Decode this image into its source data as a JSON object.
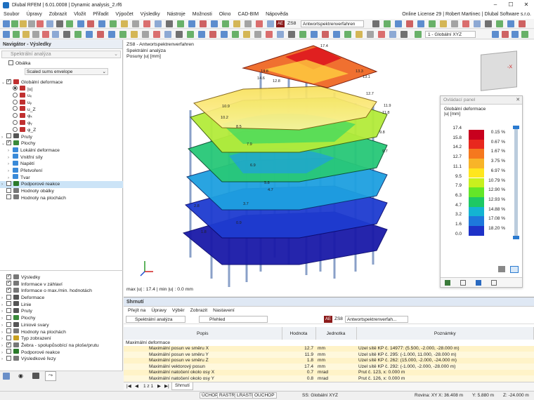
{
  "window": {
    "title": "Dlubal RFEM | 6.01.0008 | Dynamic analysis_2.rf6"
  },
  "menu": {
    "items": [
      "Soubor",
      "Úpravy",
      "Zobrazit",
      "Vložit",
      "Přiřadit",
      "Výpočet",
      "Výsledky",
      "Nástroje",
      "Možnosti",
      "Okno",
      "CAD-BIM",
      "Nápověda"
    ],
    "license": "Online License 29 | Robert Martinec | Dlubal Software s.r.o."
  },
  "toolbar": {
    "badge": "AE",
    "loadcase": "ZS8",
    "loadcase_name": "Antwortspektrenverfahren",
    "view_badge": "1 - Globální XYZ"
  },
  "navigator": {
    "title": "Navigátor - Výsledky",
    "dropdown": "Spektrální analýza",
    "envelope_label": "Obálka",
    "envelope_value": "Scaled sums envelope",
    "tree": [
      {
        "label": "Globální deformace",
        "indent": 0,
        "kind": "check",
        "on": true,
        "tw": "⌄",
        "icon": "#c03030"
      },
      {
        "label": "|u|",
        "indent": 1,
        "kind": "radio",
        "on": true,
        "icon": "#c03030"
      },
      {
        "label": "uₓ",
        "indent": 1,
        "kind": "radio",
        "on": false,
        "icon": "#c03030"
      },
      {
        "label": "uᵧ",
        "indent": 1,
        "kind": "radio",
        "on": false,
        "icon": "#c03030"
      },
      {
        "label": "u_Z",
        "indent": 1,
        "kind": "radio",
        "on": false,
        "icon": "#c03030"
      },
      {
        "label": "φₓ",
        "indent": 1,
        "kind": "radio",
        "on": false,
        "icon": "#c03030"
      },
      {
        "label": "φᵧ",
        "indent": 1,
        "kind": "radio",
        "on": false,
        "icon": "#c03030"
      },
      {
        "label": "φ_Z",
        "indent": 1,
        "kind": "radio",
        "on": false,
        "icon": "#c03030"
      },
      {
        "label": "Pruty",
        "indent": 0,
        "kind": "check",
        "on": false,
        "tw": "›",
        "icon": "#555"
      },
      {
        "label": "Plochy",
        "indent": 0,
        "kind": "check",
        "on": true,
        "tw": "⌄",
        "icon": "#3a8a3a"
      },
      {
        "label": "Lokální deformace",
        "indent": 1,
        "kind": "none",
        "tw": "›",
        "icon": "#3a8ad8"
      },
      {
        "label": "Vnitřní síly",
        "indent": 1,
        "kind": "none",
        "tw": "›",
        "icon": "#3a8ad8"
      },
      {
        "label": "Napětí",
        "indent": 1,
        "kind": "none",
        "tw": "›",
        "icon": "#3a8ad8"
      },
      {
        "label": "Přetvoření",
        "indent": 1,
        "kind": "none",
        "tw": "›",
        "icon": "#3a8ad8"
      },
      {
        "label": "Tvar",
        "indent": 1,
        "kind": "none",
        "tw": "›",
        "icon": "#3a8ad8"
      },
      {
        "label": "Podporové reakce",
        "indent": 0,
        "kind": "check",
        "on": false,
        "tw": "›",
        "icon": "#2a7a2a",
        "sel": true
      },
      {
        "label": "Hodnoty obálky",
        "indent": 0,
        "kind": "check",
        "on": false,
        "tw": "",
        "icon": "#777"
      },
      {
        "label": "Hodnoty na plochách",
        "indent": 0,
        "kind": "check",
        "on": false,
        "tw": "",
        "icon": "#777"
      }
    ],
    "tree2": [
      {
        "label": "Výsledky",
        "on": true,
        "tw": "",
        "icon": "#777"
      },
      {
        "label": "Informace v záhlaví",
        "on": true,
        "tw": "",
        "icon": "#777"
      },
      {
        "label": "Informace o max./min. hodnotách",
        "on": true,
        "tw": "",
        "icon": "#777"
      },
      {
        "label": "Deformace",
        "on": false,
        "tw": "›",
        "icon": "#555"
      },
      {
        "label": "Linie",
        "on": false,
        "tw": "›",
        "icon": "#555"
      },
      {
        "label": "Pruty",
        "on": false,
        "tw": "›",
        "icon": "#555"
      },
      {
        "label": "Plochy",
        "on": false,
        "tw": "›",
        "icon": "#3a8a3a"
      },
      {
        "label": "Liniové svary",
        "on": false,
        "tw": "›",
        "icon": "#555"
      },
      {
        "label": "Hodnoty na plochách",
        "on": false,
        "tw": "›",
        "icon": "#777"
      },
      {
        "label": "Typ zobrazení",
        "on": false,
        "tw": "›",
        "icon": "#c8a020"
      },
      {
        "label": "Žebra - spolupůsobící na ploše/prutu",
        "on": true,
        "tw": "›",
        "icon": "#777"
      },
      {
        "label": "Podporové reakce",
        "on": false,
        "tw": "›",
        "icon": "#2a7a2a"
      },
      {
        "label": "Výsledkové řezy",
        "on": false,
        "tw": "›",
        "icon": "#777"
      }
    ]
  },
  "viewport": {
    "line1": "ZS8 - Antwortspektrenverfahren",
    "line2": "Spektrální analýza",
    "line3": "Posuny |u| [mm]",
    "footer": "max |u| : 17.4 | min |u| : 0.0 mm"
  },
  "control_panel": {
    "title": "Ovládací panel",
    "heading": "Globální deformace",
    "unit": "|u| [mm]",
    "legend": [
      {
        "value": "17.4",
        "pct": "0.15 %",
        "color": "#c8001e"
      },
      {
        "value": "15.8",
        "pct": "0.67 %",
        "color": "#e8281e"
      },
      {
        "value": "14.2",
        "pct": "1.67 %",
        "color": "#f5781e"
      },
      {
        "value": "12.7",
        "pct": "3.75 %",
        "color": "#f8b428"
      },
      {
        "value": "11.1",
        "pct": "6.97 %",
        "color": "#ffe61e"
      },
      {
        "value": "9.5",
        "pct": "10.79 %",
        "color": "#c8f01e"
      },
      {
        "value": "7.9",
        "pct": "12.90 %",
        "color": "#64e628"
      },
      {
        "value": "6.3",
        "pct": "12.93 %",
        "color": "#1ec864"
      },
      {
        "value": "4.7",
        "pct": "14.88 %",
        "color": "#14b4d2"
      },
      {
        "value": "3.2",
        "pct": "17.08 %",
        "color": "#1e78dc"
      },
      {
        "value": "1.6",
        "pct": "18.20 %",
        "color": "#1e32c8"
      },
      {
        "value": "0.0",
        "pct": "",
        "color": "#0a0a96"
      }
    ]
  },
  "model_labels": [
    {
      "t": "17.4"
    },
    {
      "t": "14.8"
    },
    {
      "t": "14.6"
    },
    {
      "t": "13.3"
    },
    {
      "t": "13.1"
    },
    {
      "t": "12.8"
    },
    {
      "t": "12.7"
    },
    {
      "t": "11.9"
    },
    {
      "t": "11.8"
    },
    {
      "t": "10.9"
    },
    {
      "t": "10.2"
    },
    {
      "t": "9.8"
    },
    {
      "t": "9.7"
    },
    {
      "t": "8.5"
    },
    {
      "t": "7.9"
    },
    {
      "t": "6.9"
    },
    {
      "t": "5.8"
    },
    {
      "t": "4.7"
    },
    {
      "t": "3.7"
    },
    {
      "t": "2.8"
    },
    {
      "t": "1.8"
    },
    {
      "t": "0.9"
    }
  ],
  "summary": {
    "title": "Shrnutí",
    "menu": [
      "Přejít na",
      "Úpravy",
      "Výběr",
      "Zobrazit",
      "Nastavení"
    ],
    "combo1": "Spektrální analýza",
    "combo2": "Přehled",
    "badge": "AE",
    "loadcase": "ZS8",
    "loadcase_name": "Antwortspektrenverfah...",
    "headers": [
      "Popis",
      "Hodnota",
      "Jednotka",
      "Poznámky"
    ],
    "group": "Maximální deformace",
    "rows": [
      [
        "Maximální posun ve směru X",
        "12.7",
        "mm",
        "Uzel sítě KP č. 14977: (5.500, -2.000, -28.000 m)"
      ],
      [
        "Maximální posun ve směru Y",
        "11.9",
        "mm",
        "Uzel sítě KP č. 295: (-1.000, 11.000, -28.000 m)"
      ],
      [
        "Maximální posun ve směru Z",
        "1.8",
        "mm",
        "Uzel sítě KP č. 262: (15.000, -2.000, -24.000 m)"
      ],
      [
        "Maximální vektorový posun",
        "17.4",
        "mm",
        "Uzel sítě KP č. 292: (-1.000, -2.000, -28.000 m)"
      ],
      [
        "Maximální natočení okolo osy X",
        "0.7",
        "mrad",
        "Prut č. 123, x: 0.000 m"
      ],
      [
        "Maximální natočení okolo osy Y",
        "0.8",
        "mrad",
        "Prut č. 126, x: 0.000 m"
      ]
    ],
    "pager": "1 z 1",
    "tab": "Shrnutí"
  },
  "statusbar": {
    "toggles": [
      "ÚCHOP",
      "RASTR",
      "LRASTR",
      "OUCHOP"
    ],
    "ss": "SS: Globální XYZ",
    "plane": "Rovina: XY",
    "x": "X: 36.408 m",
    "y": "Y: 5.880 m",
    "z": "Z: -24.000 m"
  }
}
